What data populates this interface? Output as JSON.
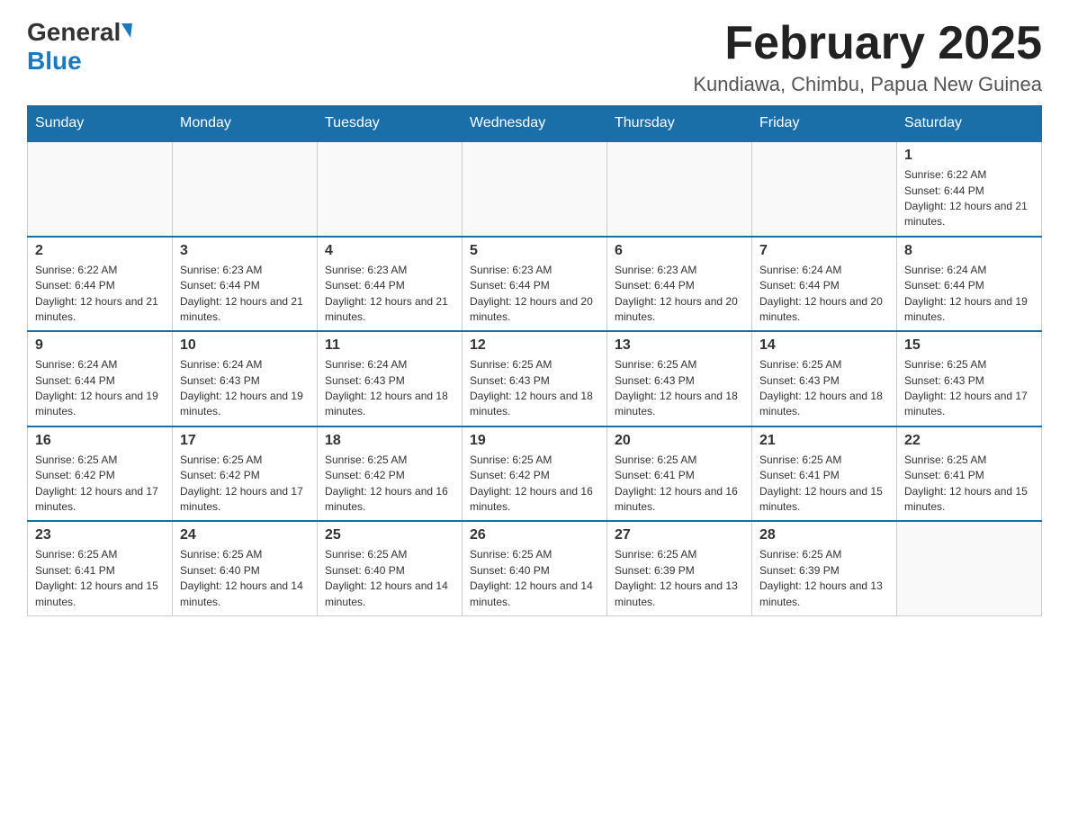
{
  "header": {
    "logo_general": "General",
    "logo_blue": "Blue",
    "month_title": "February 2025",
    "location": "Kundiawa, Chimbu, Papua New Guinea"
  },
  "weekdays": [
    "Sunday",
    "Monday",
    "Tuesday",
    "Wednesday",
    "Thursday",
    "Friday",
    "Saturday"
  ],
  "weeks": [
    {
      "days": [
        {
          "date": "",
          "info": ""
        },
        {
          "date": "",
          "info": ""
        },
        {
          "date": "",
          "info": ""
        },
        {
          "date": "",
          "info": ""
        },
        {
          "date": "",
          "info": ""
        },
        {
          "date": "",
          "info": ""
        },
        {
          "date": "1",
          "info": "Sunrise: 6:22 AM\nSunset: 6:44 PM\nDaylight: 12 hours and 21 minutes."
        }
      ]
    },
    {
      "days": [
        {
          "date": "2",
          "info": "Sunrise: 6:22 AM\nSunset: 6:44 PM\nDaylight: 12 hours and 21 minutes."
        },
        {
          "date": "3",
          "info": "Sunrise: 6:23 AM\nSunset: 6:44 PM\nDaylight: 12 hours and 21 minutes."
        },
        {
          "date": "4",
          "info": "Sunrise: 6:23 AM\nSunset: 6:44 PM\nDaylight: 12 hours and 21 minutes."
        },
        {
          "date": "5",
          "info": "Sunrise: 6:23 AM\nSunset: 6:44 PM\nDaylight: 12 hours and 20 minutes."
        },
        {
          "date": "6",
          "info": "Sunrise: 6:23 AM\nSunset: 6:44 PM\nDaylight: 12 hours and 20 minutes."
        },
        {
          "date": "7",
          "info": "Sunrise: 6:24 AM\nSunset: 6:44 PM\nDaylight: 12 hours and 20 minutes."
        },
        {
          "date": "8",
          "info": "Sunrise: 6:24 AM\nSunset: 6:44 PM\nDaylight: 12 hours and 19 minutes."
        }
      ]
    },
    {
      "days": [
        {
          "date": "9",
          "info": "Sunrise: 6:24 AM\nSunset: 6:44 PM\nDaylight: 12 hours and 19 minutes."
        },
        {
          "date": "10",
          "info": "Sunrise: 6:24 AM\nSunset: 6:43 PM\nDaylight: 12 hours and 19 minutes."
        },
        {
          "date": "11",
          "info": "Sunrise: 6:24 AM\nSunset: 6:43 PM\nDaylight: 12 hours and 18 minutes."
        },
        {
          "date": "12",
          "info": "Sunrise: 6:25 AM\nSunset: 6:43 PM\nDaylight: 12 hours and 18 minutes."
        },
        {
          "date": "13",
          "info": "Sunrise: 6:25 AM\nSunset: 6:43 PM\nDaylight: 12 hours and 18 minutes."
        },
        {
          "date": "14",
          "info": "Sunrise: 6:25 AM\nSunset: 6:43 PM\nDaylight: 12 hours and 18 minutes."
        },
        {
          "date": "15",
          "info": "Sunrise: 6:25 AM\nSunset: 6:43 PM\nDaylight: 12 hours and 17 minutes."
        }
      ]
    },
    {
      "days": [
        {
          "date": "16",
          "info": "Sunrise: 6:25 AM\nSunset: 6:42 PM\nDaylight: 12 hours and 17 minutes."
        },
        {
          "date": "17",
          "info": "Sunrise: 6:25 AM\nSunset: 6:42 PM\nDaylight: 12 hours and 17 minutes."
        },
        {
          "date": "18",
          "info": "Sunrise: 6:25 AM\nSunset: 6:42 PM\nDaylight: 12 hours and 16 minutes."
        },
        {
          "date": "19",
          "info": "Sunrise: 6:25 AM\nSunset: 6:42 PM\nDaylight: 12 hours and 16 minutes."
        },
        {
          "date": "20",
          "info": "Sunrise: 6:25 AM\nSunset: 6:41 PM\nDaylight: 12 hours and 16 minutes."
        },
        {
          "date": "21",
          "info": "Sunrise: 6:25 AM\nSunset: 6:41 PM\nDaylight: 12 hours and 15 minutes."
        },
        {
          "date": "22",
          "info": "Sunrise: 6:25 AM\nSunset: 6:41 PM\nDaylight: 12 hours and 15 minutes."
        }
      ]
    },
    {
      "days": [
        {
          "date": "23",
          "info": "Sunrise: 6:25 AM\nSunset: 6:41 PM\nDaylight: 12 hours and 15 minutes."
        },
        {
          "date": "24",
          "info": "Sunrise: 6:25 AM\nSunset: 6:40 PM\nDaylight: 12 hours and 14 minutes."
        },
        {
          "date": "25",
          "info": "Sunrise: 6:25 AM\nSunset: 6:40 PM\nDaylight: 12 hours and 14 minutes."
        },
        {
          "date": "26",
          "info": "Sunrise: 6:25 AM\nSunset: 6:40 PM\nDaylight: 12 hours and 14 minutes."
        },
        {
          "date": "27",
          "info": "Sunrise: 6:25 AM\nSunset: 6:39 PM\nDaylight: 12 hours and 13 minutes."
        },
        {
          "date": "28",
          "info": "Sunrise: 6:25 AM\nSunset: 6:39 PM\nDaylight: 12 hours and 13 minutes."
        },
        {
          "date": "",
          "info": ""
        }
      ]
    }
  ]
}
